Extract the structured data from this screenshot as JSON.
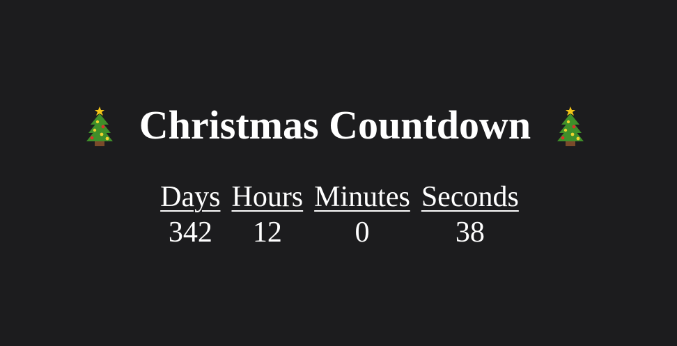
{
  "header": {
    "title": "Christmas Countdown",
    "left_icon": "christmas-tree-icon",
    "right_icon": "christmas-tree-icon"
  },
  "countdown": {
    "columns": [
      {
        "label": "Days",
        "value": "342"
      },
      {
        "label": "Hours",
        "value": "12"
      },
      {
        "label": "Minutes",
        "value": "0"
      },
      {
        "label": "Seconds",
        "value": "38"
      }
    ]
  },
  "colors": {
    "background": "#1c1c1e",
    "text": "#ffffff",
    "tree_green": "#3f8f2a",
    "trunk_brown": "#7a4a2a",
    "star_gold": "#f5c518",
    "ornament_red": "#d9342b",
    "ornament_yellow": "#f2d22e"
  }
}
